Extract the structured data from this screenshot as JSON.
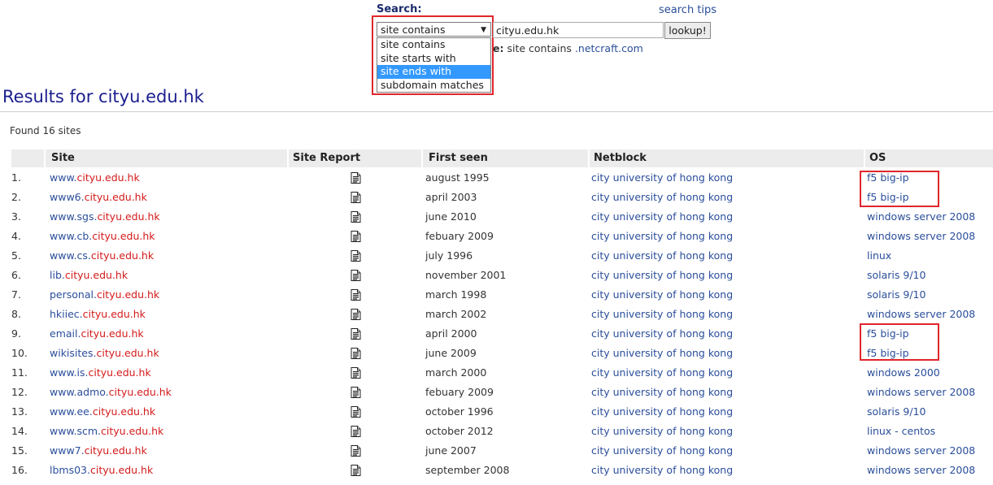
{
  "search": {
    "label": "Search:",
    "tips_label": "search tips",
    "selected_option": "site contains",
    "options": [
      "site contains",
      "site starts with",
      "site ends with",
      "subdomain matches"
    ],
    "highlighted_option": "site ends with",
    "input_value": "cityu.edu.hk",
    "button_label": "lookup!",
    "example_prefix": "e:",
    "example_text": "site contains",
    "example_link": ".netcraft.com"
  },
  "results": {
    "title": "Results for cityu.edu.hk",
    "found_text": "Found 16 sites",
    "columns": [
      "Site",
      "Site Report",
      "First seen",
      "Netblock",
      "OS"
    ],
    "rows": [
      {
        "index": "1.",
        "sub": "www.",
        "domain": "cityu.edu.hk",
        "first_seen": "august 1995",
        "netblock": "city university of hong kong",
        "os": "f5 big-ip"
      },
      {
        "index": "2.",
        "sub": "www6.",
        "domain": "cityu.edu.hk",
        "first_seen": "april 2003",
        "netblock": "city university of hong kong",
        "os": "f5 big-ip"
      },
      {
        "index": "3.",
        "sub": "www.sgs.",
        "domain": "cityu.edu.hk",
        "first_seen": "june 2010",
        "netblock": "city university of hong kong",
        "os": "windows server 2008"
      },
      {
        "index": "4.",
        "sub": "www.cb.",
        "domain": "cityu.edu.hk",
        "first_seen": "febuary 2009",
        "netblock": "city university of hong kong",
        "os": "windows server 2008"
      },
      {
        "index": "5.",
        "sub": "www.cs.",
        "domain": "cityu.edu.hk",
        "first_seen": "july 1996",
        "netblock": "city university of hong kong",
        "os": "linux"
      },
      {
        "index": "6.",
        "sub": "lib.",
        "domain": "cityu.edu.hk",
        "first_seen": "november 2001",
        "netblock": "city university of hong kong",
        "os": "solaris 9/10"
      },
      {
        "index": "7.",
        "sub": "personal.",
        "domain": "cityu.edu.hk",
        "first_seen": "march 1998",
        "netblock": "city university of hong kong",
        "os": "solaris 9/10"
      },
      {
        "index": "8.",
        "sub": "hkiiec.",
        "domain": "cityu.edu.hk",
        "first_seen": "march 2002",
        "netblock": "city university of hong kong",
        "os": "windows server 2008"
      },
      {
        "index": "9.",
        "sub": "email.",
        "domain": "cityu.edu.hk",
        "first_seen": "april 2000",
        "netblock": "city university of hong kong",
        "os": "f5 big-ip"
      },
      {
        "index": "10.",
        "sub": "wikisites.",
        "domain": "cityu.edu.hk",
        "first_seen": "june 2009",
        "netblock": "city university of hong kong",
        "os": "f5 big-ip"
      },
      {
        "index": "11.",
        "sub": "www.is.",
        "domain": "cityu.edu.hk",
        "first_seen": "march 2000",
        "netblock": "city university of hong kong",
        "os": "windows 2000"
      },
      {
        "index": "12.",
        "sub": "www.admo.",
        "domain": "cityu.edu.hk",
        "first_seen": "febuary 2009",
        "netblock": "city university of hong kong",
        "os": "windows server 2008"
      },
      {
        "index": "13.",
        "sub": "www.ee.",
        "domain": "cityu.edu.hk",
        "first_seen": "october 1996",
        "netblock": "city university of hong kong",
        "os": "solaris 9/10"
      },
      {
        "index": "14.",
        "sub": "www.scm.",
        "domain": "cityu.edu.hk",
        "first_seen": "october 2012",
        "netblock": "city university of hong kong",
        "os": "linux - centos"
      },
      {
        "index": "15.",
        "sub": "www7.",
        "domain": "cityu.edu.hk",
        "first_seen": "june 2007",
        "netblock": "city university of hong kong",
        "os": "windows server 2008"
      },
      {
        "index": "16.",
        "sub": "lbms03.",
        "domain": "cityu.edu.hk",
        "first_seen": "september 2008",
        "netblock": "city university of hong kong",
        "os": "windows server 2008"
      }
    ]
  },
  "icons": {
    "site_report": "document-icon",
    "dropdown": "triangle-down-icon"
  },
  "colors": {
    "title": "#1a1f8e",
    "link": "#2a4e9a",
    "domain_highlight": "#d41b1b",
    "annotation_box": "#e0262c",
    "header_bg": "#ececec",
    "option_highlight": "#3399ff"
  }
}
